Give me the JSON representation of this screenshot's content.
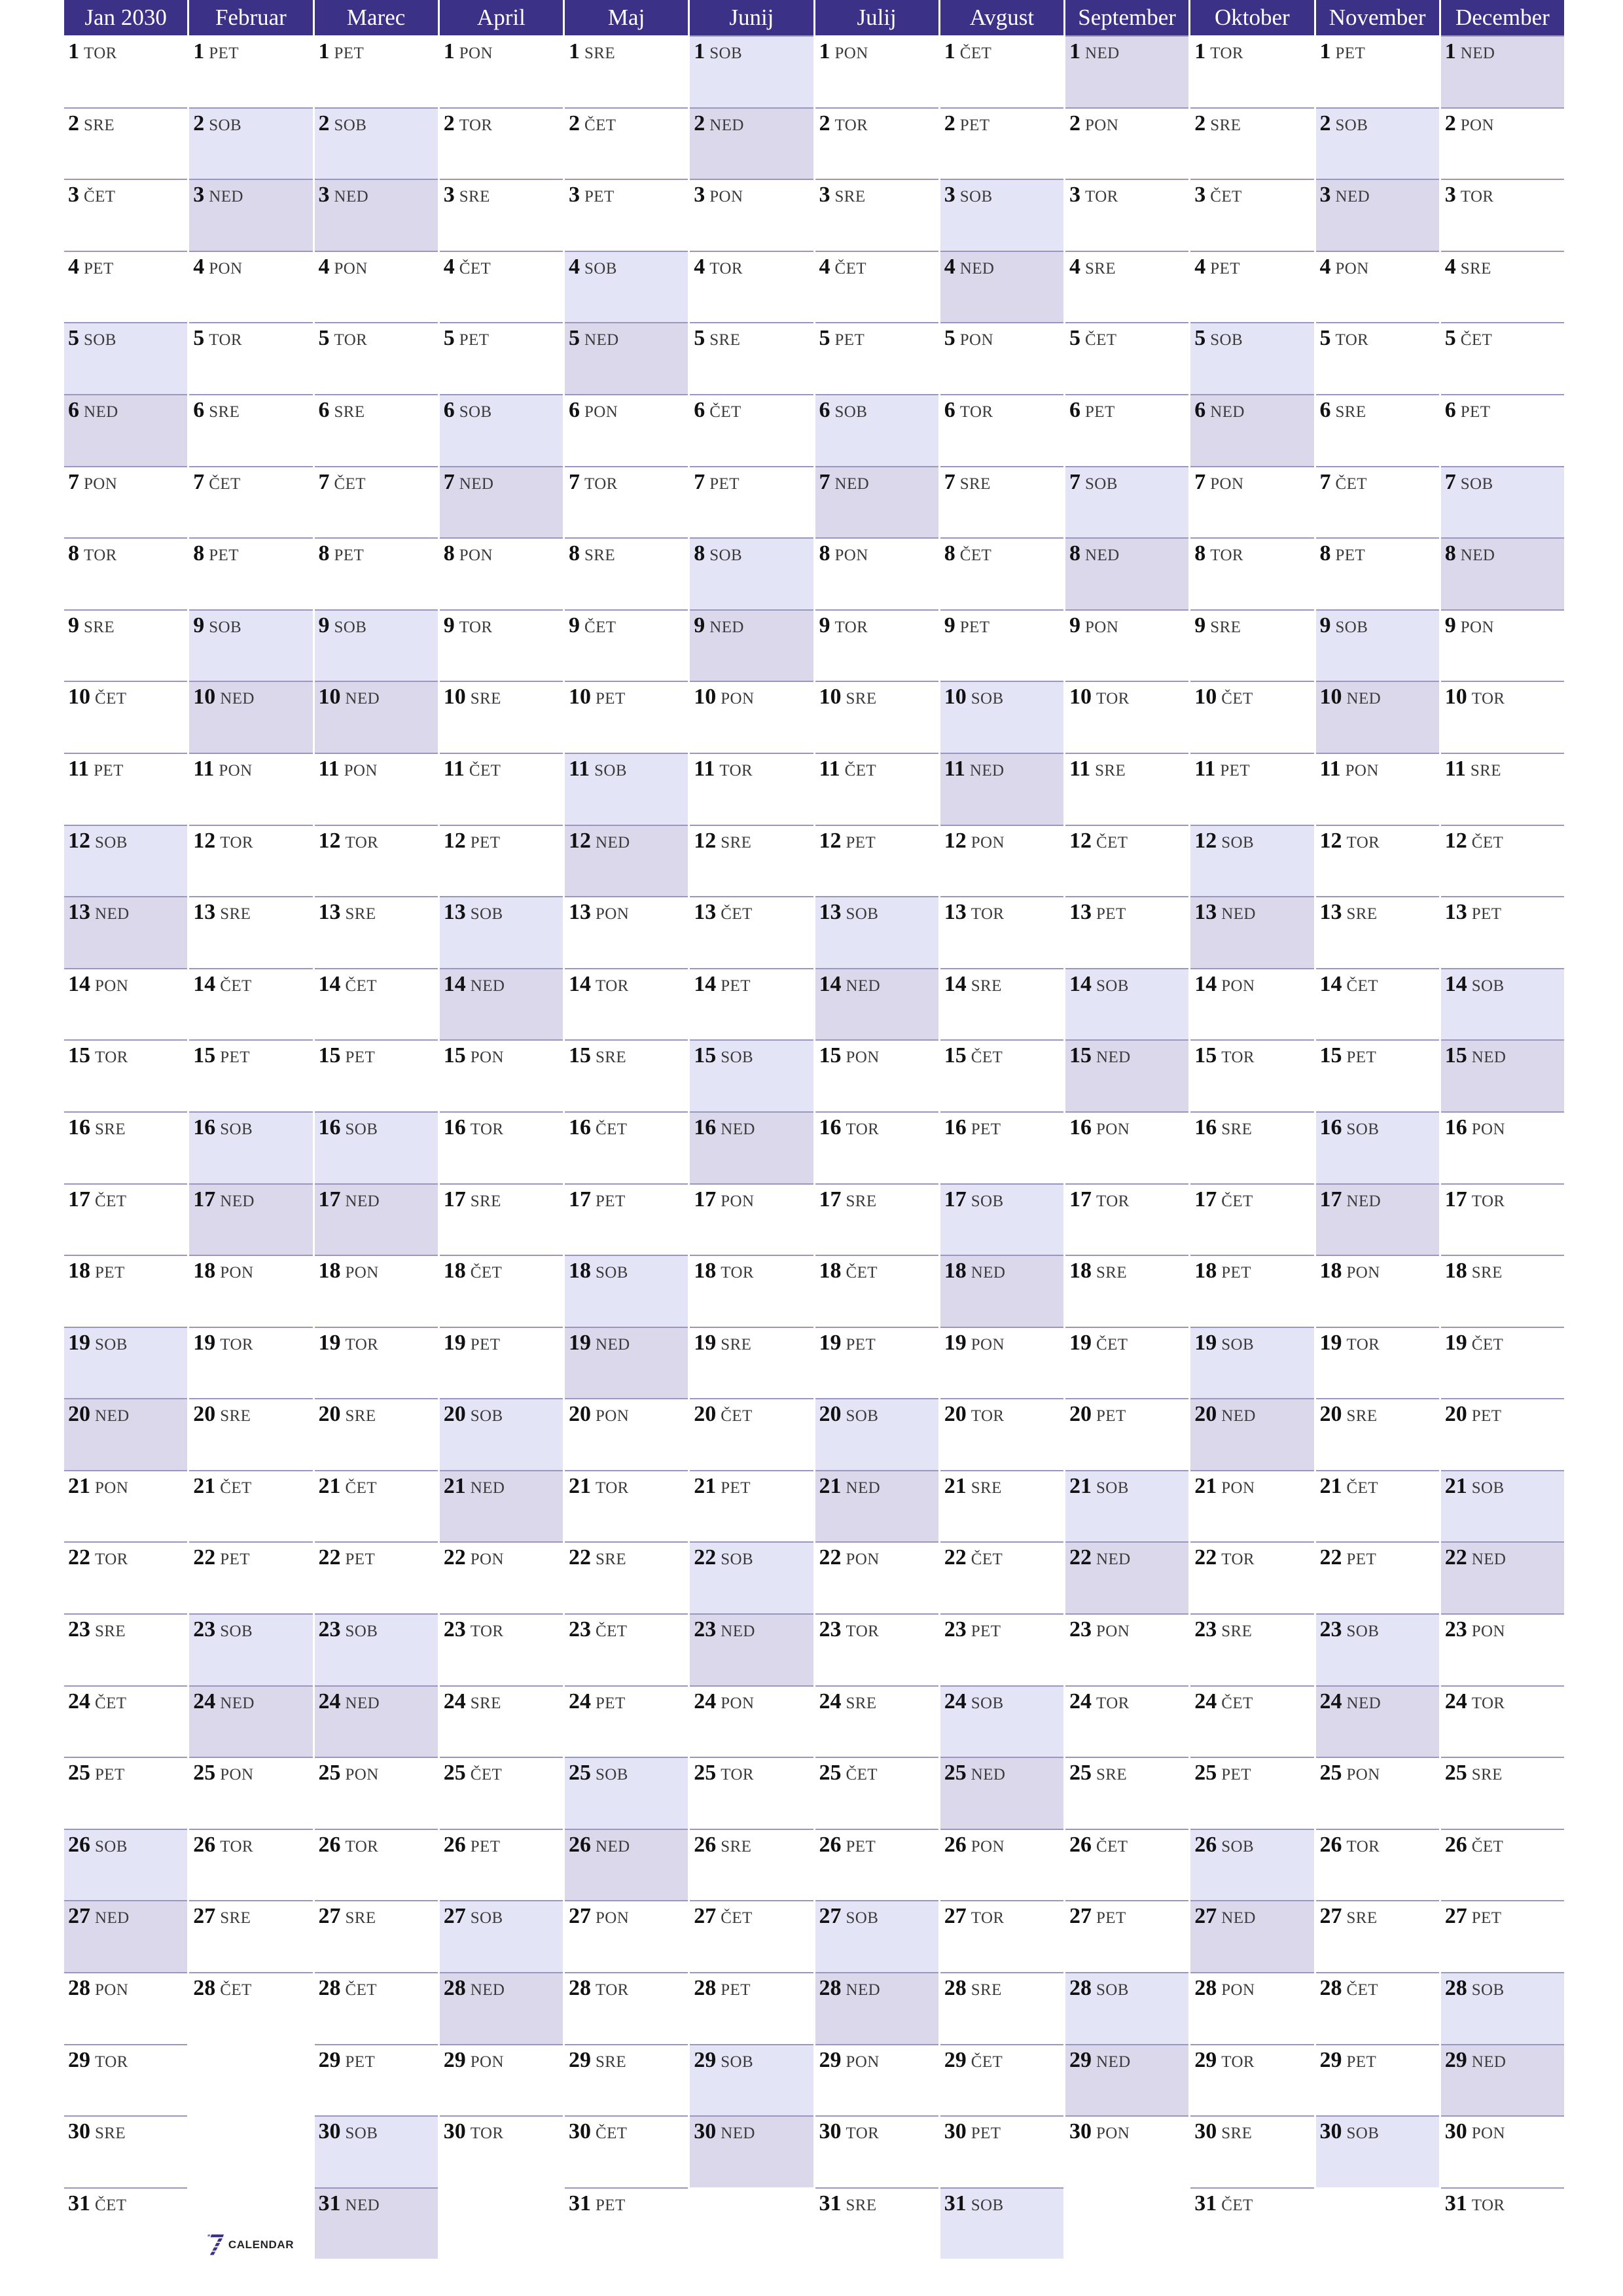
{
  "document": {
    "type": "year-planner",
    "year": "2030",
    "locale": "sl",
    "title": "Jan 2030"
  },
  "colors": {
    "header_bg": "#3B3287",
    "header_text": "#FFFFFF",
    "saturday_bg": "#E4E4F7",
    "sunday_bg": "#DCD8EC",
    "separator": "#9A96C0",
    "day_number": "#111111",
    "day_name": "#3A3A3A",
    "logo_mark": "#3B3287"
  },
  "logo": {
    "mark": "seven-logo-icon",
    "text": "CALENDAR"
  },
  "weekday_abbr": {
    "monday": "PON",
    "tuesday": "TOR",
    "wednesday": "SRE",
    "thursday": "ČET",
    "friday": "PET",
    "saturday": "SOB",
    "sunday": "NED"
  },
  "months": [
    {
      "label": "Jan 2030",
      "days": [
        "TOR",
        "SRE",
        "ČET",
        "PET",
        "SOB",
        "NED",
        "PON",
        "TOR",
        "SRE",
        "ČET",
        "PET",
        "SOB",
        "NED",
        "PON",
        "TOR",
        "SRE",
        "ČET",
        "PET",
        "SOB",
        "NED",
        "PON",
        "TOR",
        "SRE",
        "ČET",
        "PET",
        "SOB",
        "NED",
        "PON",
        "TOR",
        "SRE",
        "ČET"
      ]
    },
    {
      "label": "Februar",
      "days": [
        "PET",
        "SOB",
        "NED",
        "PON",
        "TOR",
        "SRE",
        "ČET",
        "PET",
        "SOB",
        "NED",
        "PON",
        "TOR",
        "SRE",
        "ČET",
        "PET",
        "SOB",
        "NED",
        "PON",
        "TOR",
        "SRE",
        "ČET",
        "PET",
        "SOB",
        "NED",
        "PON",
        "TOR",
        "SRE",
        "ČET"
      ]
    },
    {
      "label": "Marec",
      "days": [
        "PET",
        "SOB",
        "NED",
        "PON",
        "TOR",
        "SRE",
        "ČET",
        "PET",
        "SOB",
        "NED",
        "PON",
        "TOR",
        "SRE",
        "ČET",
        "PET",
        "SOB",
        "NED",
        "PON",
        "TOR",
        "SRE",
        "ČET",
        "PET",
        "SOB",
        "NED",
        "PON",
        "TOR",
        "SRE",
        "ČET",
        "PET",
        "SOB",
        "NED"
      ]
    },
    {
      "label": "April",
      "days": [
        "PON",
        "TOR",
        "SRE",
        "ČET",
        "PET",
        "SOB",
        "NED",
        "PON",
        "TOR",
        "SRE",
        "ČET",
        "PET",
        "SOB",
        "NED",
        "PON",
        "TOR",
        "SRE",
        "ČET",
        "PET",
        "SOB",
        "NED",
        "PON",
        "TOR",
        "SRE",
        "ČET",
        "PET",
        "SOB",
        "NED",
        "PON",
        "TOR"
      ]
    },
    {
      "label": "Maj",
      "days": [
        "SRE",
        "ČET",
        "PET",
        "SOB",
        "NED",
        "PON",
        "TOR",
        "SRE",
        "ČET",
        "PET",
        "SOB",
        "NED",
        "PON",
        "TOR",
        "SRE",
        "ČET",
        "PET",
        "SOB",
        "NED",
        "PON",
        "TOR",
        "SRE",
        "ČET",
        "PET",
        "SOB",
        "NED",
        "PON",
        "TOR",
        "SRE",
        "ČET",
        "PET"
      ]
    },
    {
      "label": "Junij",
      "days": [
        "SOB",
        "NED",
        "PON",
        "TOR",
        "SRE",
        "ČET",
        "PET",
        "SOB",
        "NED",
        "PON",
        "TOR",
        "SRE",
        "ČET",
        "PET",
        "SOB",
        "NED",
        "PON",
        "TOR",
        "SRE",
        "ČET",
        "PET",
        "SOB",
        "NED",
        "PON",
        "TOR",
        "SRE",
        "ČET",
        "PET",
        "SOB",
        "NED"
      ]
    },
    {
      "label": "Julij",
      "days": [
        "PON",
        "TOR",
        "SRE",
        "ČET",
        "PET",
        "SOB",
        "NED",
        "PON",
        "TOR",
        "SRE",
        "ČET",
        "PET",
        "SOB",
        "NED",
        "PON",
        "TOR",
        "SRE",
        "ČET",
        "PET",
        "SOB",
        "NED",
        "PON",
        "TOR",
        "SRE",
        "ČET",
        "PET",
        "SOB",
        "NED",
        "PON",
        "TOR",
        "SRE"
      ]
    },
    {
      "label": "Avgust",
      "days": [
        "ČET",
        "PET",
        "SOB",
        "NED",
        "PON",
        "TOR",
        "SRE",
        "ČET",
        "PET",
        "SOB",
        "NED",
        "PON",
        "TOR",
        "SRE",
        "ČET",
        "PET",
        "SOB",
        "NED",
        "PON",
        "TOR",
        "SRE",
        "ČET",
        "PET",
        "SOB",
        "NED",
        "PON",
        "TOR",
        "SRE",
        "ČET",
        "PET",
        "SOB"
      ]
    },
    {
      "label": "September",
      "days": [
        "NED",
        "PON",
        "TOR",
        "SRE",
        "ČET",
        "PET",
        "SOB",
        "NED",
        "PON",
        "TOR",
        "SRE",
        "ČET",
        "PET",
        "SOB",
        "NED",
        "PON",
        "TOR",
        "SRE",
        "ČET",
        "PET",
        "SOB",
        "NED",
        "PON",
        "TOR",
        "SRE",
        "ČET",
        "PET",
        "SOB",
        "NED",
        "PON"
      ]
    },
    {
      "label": "Oktober",
      "days": [
        "TOR",
        "SRE",
        "ČET",
        "PET",
        "SOB",
        "NED",
        "PON",
        "TOR",
        "SRE",
        "ČET",
        "PET",
        "SOB",
        "NED",
        "PON",
        "TOR",
        "SRE",
        "ČET",
        "PET",
        "SOB",
        "NED",
        "PON",
        "TOR",
        "SRE",
        "ČET",
        "PET",
        "SOB",
        "NED",
        "PON",
        "TOR",
        "SRE",
        "ČET"
      ]
    },
    {
      "label": "November",
      "days": [
        "PET",
        "SOB",
        "NED",
        "PON",
        "TOR",
        "SRE",
        "ČET",
        "PET",
        "SOB",
        "NED",
        "PON",
        "TOR",
        "SRE",
        "ČET",
        "PET",
        "SOB",
        "NED",
        "PON",
        "TOR",
        "SRE",
        "ČET",
        "PET",
        "SOB",
        "NED",
        "PON",
        "TOR",
        "SRE",
        "ČET",
        "PET",
        "SOB"
      ]
    },
    {
      "label": "December",
      "days": [
        "NED",
        "PON",
        "TOR",
        "SRE",
        "ČET",
        "PET",
        "SOB",
        "NED",
        "PON",
        "TOR",
        "SRE",
        "ČET",
        "PET",
        "SOB",
        "NED",
        "PON",
        "TOR",
        "SRE",
        "ČET",
        "PET",
        "SOB",
        "NED",
        "PON",
        "TOR",
        "SRE",
        "ČET",
        "PET",
        "SOB",
        "NED",
        "PON",
        "TOR"
      ]
    }
  ]
}
